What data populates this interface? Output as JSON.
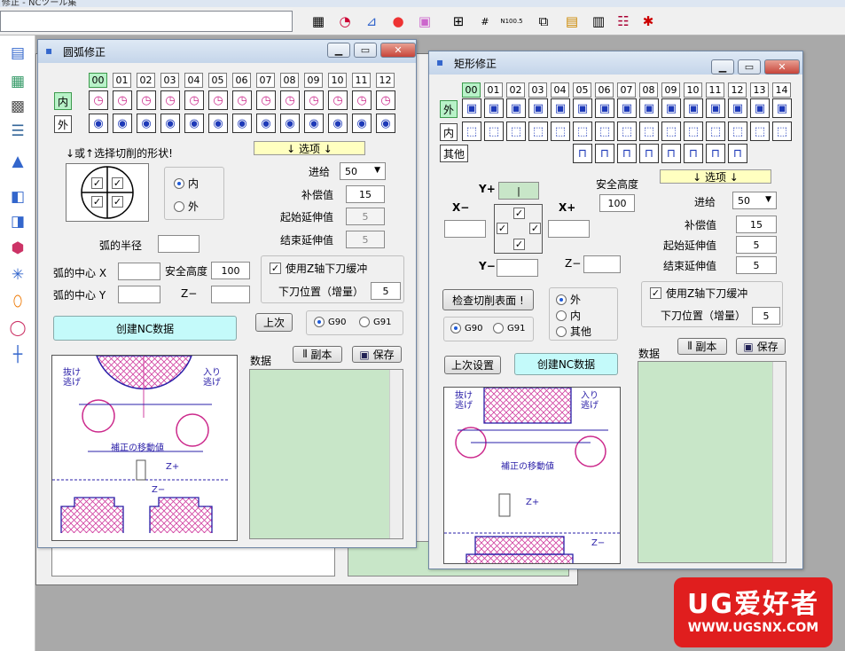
{
  "app": {
    "title_fragment": "修正 - NCツール集"
  },
  "toolbar": {
    "icons": [
      "grid-icon",
      "radius-icon",
      "taper-icon",
      "circle-icon",
      "square-icon",
      "measure-icon",
      "number-icon",
      "nc-code-icon",
      "window-copy-icon",
      "table-icon",
      "form-icon",
      "bug-icon"
    ],
    "nc_text": "N100.5"
  },
  "sidebar": {
    "icons": [
      "book-icon",
      "layer-icon",
      "grid-icon",
      "stamp-icon",
      "mountain-icon",
      "hand-icon",
      "template-icon",
      "tool-icon",
      "octagon-icon",
      "star-icon",
      "pill-icon",
      "ring-icon",
      "cross-icon"
    ]
  },
  "arc_window": {
    "title": "圆弧修正",
    "numbers": [
      "00",
      "01",
      "02",
      "03",
      "04",
      "05",
      "06",
      "07",
      "08",
      "09",
      "10",
      "11",
      "12"
    ],
    "row_labels": {
      "inner": "内",
      "outer": "外"
    },
    "instruction": "↓或↑选择切削的形状!",
    "options_label": "↓ 选项 ↓",
    "radio_inner": "内",
    "radio_outer": "外",
    "feed": {
      "label": "进给",
      "value": "50"
    },
    "comp": {
      "label": "补偿值",
      "value": "15"
    },
    "start_ext": {
      "label": "起始延伸值",
      "value": "5"
    },
    "end_ext": {
      "label": "结束延伸值",
      "value": "5"
    },
    "radius_label": "弧的半径",
    "center_x": "弧的中心  X",
    "center_y": "弧的中心  Y",
    "safe_height": {
      "label": "安全高度",
      "value": "100"
    },
    "z_minus": "Z−",
    "use_z_buffer": "使用Z轴下刀缓冲",
    "down_pos": {
      "label": "下刀位置（增量）",
      "value": "5"
    },
    "create_nc": "创建NC数据",
    "last": "上次",
    "g90": "G90",
    "g91": "G91",
    "data_label": "数据",
    "copy": "副本",
    "save": "保存",
    "diagram_text": {
      "exit_left": "抜け\n逃げ",
      "enter_right": "入り\n逃げ",
      "move": "補正の移動値",
      "zplus": "Z+",
      "zminus": "Z−"
    }
  },
  "rect_window": {
    "title": "矩形修正",
    "numbers": [
      "00",
      "01",
      "02",
      "03",
      "04",
      "05",
      "06",
      "07",
      "08",
      "09",
      "10",
      "11",
      "12",
      "13",
      "14"
    ],
    "row_labels": {
      "outer": "外",
      "inner": "内",
      "other": "其他"
    },
    "options_label": "↓ 选项 ↓",
    "y_plus": "Y+",
    "y_minus": "Y−",
    "x_minus": "X−",
    "x_plus": "X+",
    "z_minus": "Z−",
    "safe_height": {
      "label": "安全高度",
      "value": "100"
    },
    "feed": {
      "label": "进给",
      "value": "50"
    },
    "comp": {
      "label": "补偿值",
      "value": "15"
    },
    "start_ext": {
      "label": "起始延伸值",
      "value": "5"
    },
    "end_ext": {
      "label": "结束延伸值",
      "value": "5"
    },
    "check_surface": "检查切削表面 !",
    "radio_outer": "外",
    "radio_inner": "内",
    "radio_other": "其他",
    "use_z_buffer": "使用Z轴下刀缓冲",
    "down_pos": {
      "label": "下刀位置（增量）",
      "value": "5"
    },
    "g90": "G90",
    "g91": "G91",
    "last_setting": "上次设置",
    "create_nc": "创建NC数据",
    "data_label": "数据",
    "copy": "副本",
    "save": "保存",
    "diagram_text": {
      "exit_left": "抜け\n逃げ",
      "enter_right": "入り\n逃げ",
      "move": "補正の移動値",
      "zplus": "Z+",
      "zminus": "Z−"
    }
  },
  "watermark": {
    "brand": "UG爱好者",
    "url": "WWW.UGSNX.COM"
  },
  "colors": {
    "accent_green": "#b8f2c8",
    "data_green": "#c8e6c8",
    "cyan_button": "#c4fafa",
    "magenta": "#cc2a8c",
    "watermark_red": "#e01e1e"
  }
}
